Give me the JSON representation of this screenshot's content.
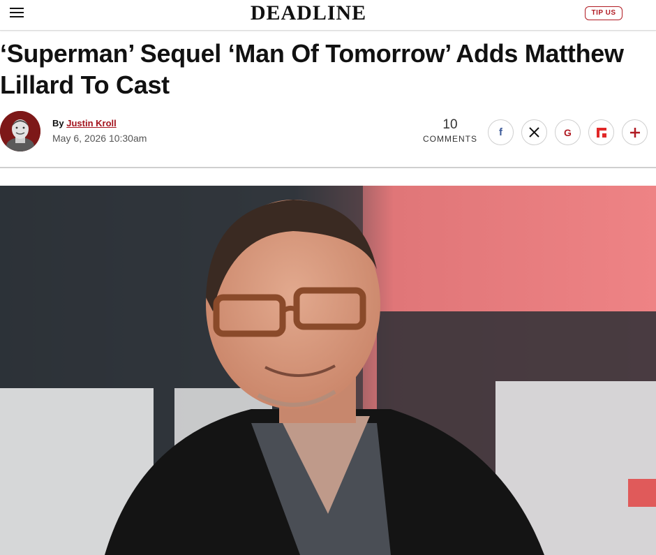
{
  "site": {
    "logo": "DEADLINE",
    "tip_label": "TIP US"
  },
  "article": {
    "headline": "‘Superman’ Sequel ‘Man Of Tomorrow’ Adds Matthew Lillard To Cast",
    "byline_prefix": "By",
    "author": "Justin Kroll",
    "date": "May 6, 2026 10:30am",
    "comments_count": "10",
    "comments_label": "COMMENTS"
  },
  "share_buttons": [
    {
      "icon": "facebook-icon",
      "glyph": "f"
    },
    {
      "icon": "x-icon",
      "glyph": "X"
    },
    {
      "icon": "google-icon",
      "glyph": "G"
    },
    {
      "icon": "flipboard-icon",
      "glyph": "flipboard"
    },
    {
      "icon": "plus-icon",
      "glyph": "+"
    }
  ],
  "colors": {
    "brand_red": "#b01a22",
    "link_red": "#a3121c",
    "facebook_blue": "#3b5998"
  }
}
